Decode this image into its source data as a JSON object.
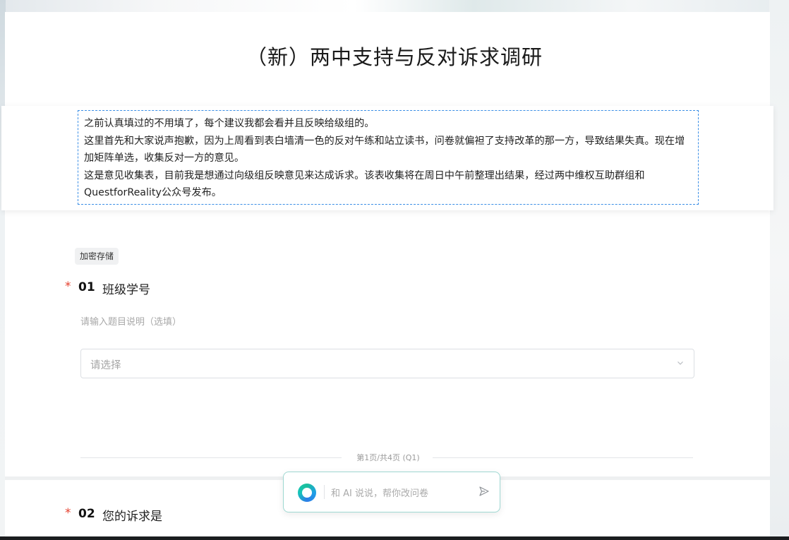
{
  "survey": {
    "title": "（新）两中支持与反对诉求调研",
    "description": [
      "之前认真填过的不用填了，每个建议我都会看并且反映给级组的。",
      "这里首先和大家说声抱歉，因为上周看到表白墙清一色的反对午练和站立读书，问卷就偏袒了支持改革的那一方，导致结果失真。现在增加矩阵单选，收集反对一方的意见。",
      "这是意见收集表，目前我是想通过向级组反映意见来达成诉求。该表收集将在周日中午前整理出结果，经过两中维权互助群组和QuestforReality公众号发布。"
    ]
  },
  "tag": "加密存储",
  "questions": [
    {
      "required_mark": "*",
      "number": "01",
      "title": "班级学号",
      "hint": "请输入题目说明（选填）",
      "select_placeholder": "请选择"
    },
    {
      "required_mark": "*",
      "number": "02",
      "title": "您的诉求是"
    }
  ],
  "pager": {
    "text": "第1页/共4页 (Q1)"
  },
  "ai_assistant": {
    "placeholder": "和 AI 说说，帮你改问卷",
    "icon": "send-icon",
    "logo": "ai-logo-icon"
  },
  "colors": {
    "required": "#e5412f",
    "dashed_border": "#3a8ee6",
    "ai_border": "#9fd8d2"
  }
}
